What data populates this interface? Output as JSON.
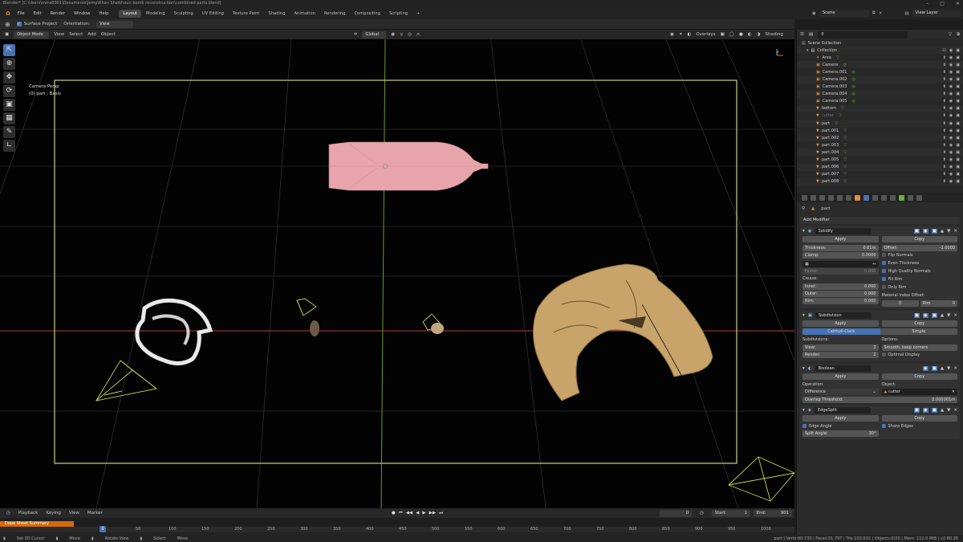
{
  "title_bar": "Blender* [C:\\Users\\mms0001\\Documents\\Jemp\\Khan Sheikhoun bomb reconstruction\\combined parts.blend]",
  "menu": [
    "File",
    "Edit",
    "Render",
    "Window",
    "Help"
  ],
  "workspaces": [
    "Layout",
    "Modeling",
    "Sculpting",
    "UV Editing",
    "Texture Paint",
    "Shading",
    "Animation",
    "Rendering",
    "Compositing",
    "Scripting",
    "+"
  ],
  "scene": {
    "scene_label": "Scene",
    "view_layer_label": "View Layer"
  },
  "tool_header": {
    "surface_project": "Surface Project",
    "orientation_label": "Orientation:",
    "orientation_value": "View"
  },
  "viewport_header": {
    "mode": "Object Mode",
    "menus": [
      "View",
      "Select",
      "Add",
      "Object"
    ],
    "transform": "Global",
    "overlays": "Overlays",
    "shading": "Shading"
  },
  "viewport": {
    "camera_label": "Camera Persp",
    "object_label": "(0) part : Basis"
  },
  "timeline": {
    "menus": [
      "Playback",
      "Keying",
      "View",
      "Marker"
    ],
    "current_frame": "0",
    "start_label": "Start:",
    "start": "1",
    "end_label": "End:",
    "end": "901",
    "ticks": [
      "0",
      "50",
      "100",
      "150",
      "200",
      "250",
      "300",
      "350",
      "400",
      "450",
      "500",
      "550",
      "600",
      "650",
      "700",
      "750",
      "800",
      "850",
      "900",
      "950",
      "1000"
    ],
    "track": "Dope Sheet Summary"
  },
  "statusbar": {
    "items": [
      "Set 3D Cursor",
      "Move",
      "Rotate View",
      "Select",
      "Move"
    ],
    "stats": "part | Verts:60,733 | Faces:51,797 | Tris:103,632 | Objects:0/20 | Mem: 112.0 MiB | v2.80.26"
  },
  "outliner": {
    "scene_collection": "Scene Collection",
    "collection": "Collection",
    "items": [
      "Area",
      "Camera",
      "Camera.001",
      "Camera.002",
      "Camera.003",
      "Camera.004",
      "Camera.005",
      "bottom",
      "cutter",
      "part",
      "part.001",
      "part.002",
      "part.003",
      "part.004",
      "part.005",
      "part.006",
      "part.007",
      "part.008"
    ]
  },
  "properties": {
    "object_name": "part",
    "add_modifier": "Add Modifier",
    "apply": "Apply",
    "copy": "Copy",
    "solidify": {
      "name": "Solidify",
      "thickness_label": "Thickness:",
      "thickness": "0.01m",
      "offset_label": "Offset:",
      "offset": "-1.0000",
      "clamp_label": "Clamp:",
      "clamp": "0.0000",
      "factor_label": "Factor:",
      "factor": "0.000",
      "crease_label": "Crease:",
      "inner_label": "Inner:",
      "inner": "0.000",
      "outer_label": "Outer:",
      "outer": "0.000",
      "rim_label": "Rim:",
      "rim": "0.000",
      "flip_normals": "Flip Normals",
      "even_thickness": "Even Thickness",
      "hq_normals": "High Quality Normals",
      "fill_rim": "Fill Rim",
      "only_rim": "Only Rim",
      "material_offset_label": "Material Index Offset:",
      "mat_offset": "0",
      "mat_rim_label": "Rim",
      "mat_rim": "0"
    },
    "subdivision": {
      "name": "Subdivision",
      "catmull": "Catmull-Clark",
      "simple": "Simple",
      "subdivisions_label": "Subdivisions:",
      "view_label": "View:",
      "view": "2",
      "render_label": "Render:",
      "render": "2",
      "options_label": "Options:",
      "smooth": "Smooth, keep corners",
      "optimal": "Optimal Display"
    },
    "boolean": {
      "name": "Boolean",
      "operation_label": "Operation:",
      "operation": "Difference",
      "object_label": "Object:",
      "object": "cutter",
      "overlap_label": "Overlap Threshold:",
      "overlap": "0.000001m"
    },
    "edgesplit": {
      "name": "EdgeSplit",
      "edge_angle": "Edge Angle",
      "sharp_edges": "Sharp Edges",
      "split_angle_label": "Split Angle:",
      "split_angle": "30°"
    }
  },
  "colors": {
    "accent": "#4772b3",
    "frame_border": "#c8d088",
    "bomb": "#e8a4ab",
    "axis_x": "#b13a47",
    "axis_y": "#6c9a2a",
    "playhead": "#4772b3",
    "track": "#d46a08"
  }
}
